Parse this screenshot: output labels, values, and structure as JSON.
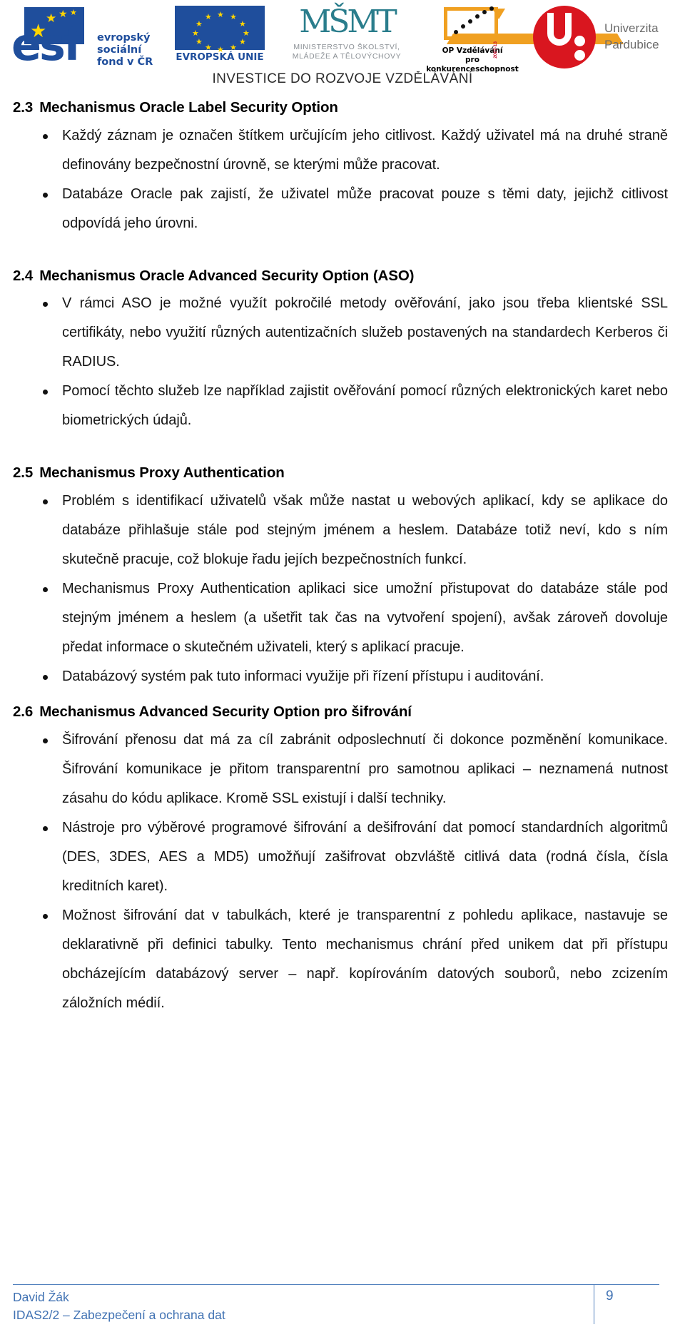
{
  "header": {
    "banner_text": "INVESTICE DO ROZVOJE VZDĚLÁVÁNÍ",
    "logos": [
      {
        "name": "esf",
        "line1": "evropský",
        "line2": "sociální",
        "line3": "fond v ČR",
        "mark_text": "esf",
        "color": "#1f4e9c"
      },
      {
        "name": "european-union",
        "caption": "EVROPSKÁ UNIE",
        "color": "#1f4e9c"
      },
      {
        "name": "msmt",
        "mark_text": "MŠMT",
        "caption_line1": "MINISTERSTVO ŠKOLSTVÍ,",
        "caption_line2": "MLÁDEŽE A TĚLOVÝCHOVY",
        "color": "#2a7d8c"
      },
      {
        "name": "op-vzdelavani",
        "caption_line1": "OP Vzdělávání",
        "caption_line2": "pro konkurenceschopnost",
        "year_mark": "2007-13",
        "color": "#f0a021"
      },
      {
        "name": "univerzita-pardubice",
        "line1": "Univerzita",
        "line2": "Pardubice",
        "color": "#d9161f"
      }
    ]
  },
  "content": {
    "sections": [
      {
        "number": "2.3",
        "title": "Mechanismus Oracle Label Security Option",
        "bullets": [
          "Každý záznam je označen štítkem určujícím jeho citlivost. Každý uživatel má na druhé straně definovány bezpečnostní úrovně, se kterými může pracovat.",
          "Databáze Oracle pak zajistí, že uživatel může pracovat pouze s těmi daty, jejichž citlivost odpovídá jeho úrovni."
        ]
      },
      {
        "number": "2.4",
        "title": "Mechanismus Oracle Advanced Security Option (ASO)",
        "bullets": [
          "V rámci ASO je možné využít pokročilé metody ověřování, jako jsou třeba klientské SSL certifikáty, nebo využití různých autentizačních služeb postavených na standardech Kerberos či RADIUS.",
          "Pomocí těchto služeb lze například zajistit ověřování pomocí různých elektronických karet nebo biometrických údajů."
        ]
      },
      {
        "number": "2.5",
        "title": "Mechanismus Proxy Authentication",
        "bullets": [
          "Problém s identifikací uživatelů však může nastat u webových aplikací, kdy se aplikace do databáze přihlašuje stále pod stejným jménem a heslem. Databáze totiž neví, kdo s ním skutečně pracuje, což blokuje řadu jejích bezpečnostních funkcí.",
          "Mechanismus Proxy Authentication aplikaci sice umožní přistupovat do databáze stále pod stejným jménem a heslem (a ušetřit tak čas na vytvoření spojení), avšak zároveň dovoluje předat informace o skutečném uživateli, který s aplikací pracuje.",
          "Databázový systém pak tuto informaci využije při řízení přístupu i auditování."
        ]
      },
      {
        "number": "2.6",
        "title": "Mechanismus Advanced Security Option pro šifrování",
        "bullets": [
          "Šifrování přenosu dat má za cíl zabránit odposlechnutí či dokonce pozměnění komunikace. Šifrování komunikace je přitom transparentní pro samotnou aplikaci – neznamená nutnost zásahu do kódu aplikace. Kromě SSL existují i další techniky.",
          "Nástroje pro výběrové programové šifrování a dešifrování dat pomocí standardních algoritmů (DES, 3DES, AES a MD5) umožňují zašifrovat obzvláště citlivá data (rodná čísla, čísla kreditních karet).",
          "Možnost šifrování dat v tabulkách, které je transparentní z pohledu aplikace, nastavuje se deklarativně při definici tabulky. Tento mechanismus chrání před unikem dat při přístupu obcházejícím databázový server – např. kopírováním datových souborů, nebo zcizením záložních médií."
        ]
      }
    ]
  },
  "footer": {
    "author": "David Žák",
    "course": "IDAS2/2 – Zabezpečení a ochrana dat",
    "page_number": "9",
    "accent_color": "#4072b3"
  }
}
